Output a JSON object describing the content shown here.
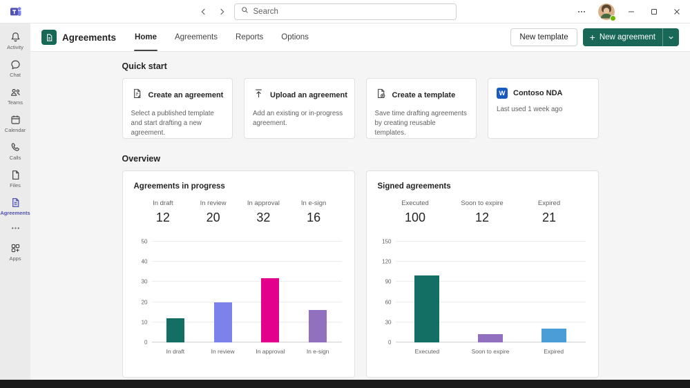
{
  "theme": {
    "accent": "#186757",
    "brand": "#4f52b2"
  },
  "topbar": {
    "search_placeholder": "Search"
  },
  "rail": {
    "items": [
      {
        "label": "Activity"
      },
      {
        "label": "Chat"
      },
      {
        "label": "Teams"
      },
      {
        "label": "Calendar"
      },
      {
        "label": "Calls"
      },
      {
        "label": "Files"
      },
      {
        "label": "Agreements"
      },
      {
        "label": "Apps"
      }
    ]
  },
  "header": {
    "title": "Agreements",
    "tabs": [
      {
        "label": "Home"
      },
      {
        "label": "Agreements"
      },
      {
        "label": "Reports"
      },
      {
        "label": "Options"
      }
    ],
    "new_template": "New template",
    "new_agreement": "New agreement",
    "plus": "+"
  },
  "quick_start": {
    "title": "Quick start",
    "cards": [
      {
        "title": "Create an agreement",
        "description": "Select a published template and start drafting a new agreement."
      },
      {
        "title": "Upload an agreement",
        "description": "Add an existing or in-progress agreement."
      },
      {
        "title": "Create a template",
        "description": "Save time drafting agreements by creating reusable templates."
      },
      {
        "title": "Contoso NDA",
        "description": "Last used 1 week ago"
      }
    ]
  },
  "overview": {
    "title": "Overview"
  },
  "chart_data": [
    {
      "type": "bar",
      "title": "Agreements in progress",
      "categories": [
        "In draft",
        "In review",
        "In approval",
        "In e-sign"
      ],
      "values": [
        12,
        20,
        32,
        16
      ],
      "colors": [
        "#136e63",
        "#7b83eb",
        "#e3008c",
        "#9070bf"
      ],
      "xlabel": "",
      "ylabel": "",
      "ylim": [
        0,
        50
      ],
      "yticks": [
        0,
        10,
        20,
        30,
        40,
        50
      ],
      "grid": true,
      "legend": "none"
    },
    {
      "type": "bar",
      "title": "Signed agreements",
      "categories": [
        "Executed",
        "Soon to expire",
        "Expired"
      ],
      "values": [
        100,
        12,
        21
      ],
      "colors": [
        "#136e63",
        "#9070bf",
        "#4a9dd6"
      ],
      "xlabel": "",
      "ylabel": "",
      "ylim": [
        0,
        150
      ],
      "yticks": [
        0,
        30,
        60,
        90,
        120,
        150
      ],
      "grid": true,
      "legend": "none"
    }
  ]
}
